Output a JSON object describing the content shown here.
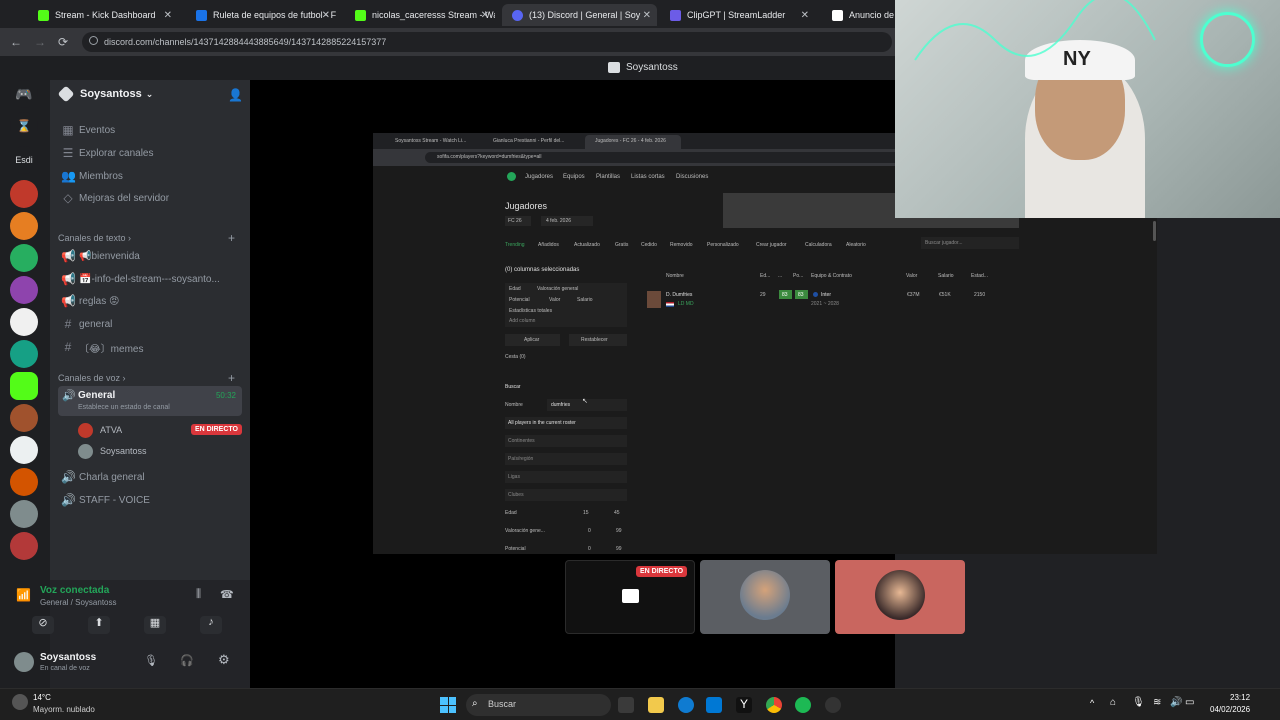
{
  "browser": {
    "tabs": [
      {
        "label": "Stream - Kick Dashboard",
        "color": "#53fc18"
      },
      {
        "label": "Ruleta de equipos de futbol - F",
        "color": "#1a73e8"
      },
      {
        "label": "nicolas_caceresss Stream - Wat",
        "color": "#53fc18"
      },
      {
        "label": "(13) Discord | General | Soy",
        "color": "#5865f2"
      },
      {
        "label": "ClipGPT | StreamLadder",
        "color": "#6c5ce7"
      },
      {
        "label": "Anuncio de las",
        "color": "#ffffff"
      }
    ],
    "url": "discord.com/channels/1437142884443885649/1437142885224157377"
  },
  "discord": {
    "top_title": "Soysantoss",
    "server_name": "Soysantoss",
    "menu": [
      "Eventos",
      "Explorar canales",
      "Miembros",
      "Mejoras del servidor"
    ],
    "text_category": "Canales de texto",
    "text_channels": [
      "📢bienvenida",
      "📅-info-del-stream---soysanto...",
      "reglas 😡",
      "general",
      "〔😂〕memes"
    ],
    "voice_category": "Canales de voz",
    "voice_channel": {
      "name": "General",
      "timer": "50:32",
      "status_placeholder": "Establece un estado de canal"
    },
    "voice_users": [
      {
        "name": "ATVA",
        "badge": "EN DIRECTO"
      },
      {
        "name": "Soysantoss",
        "badge": ""
      }
    ],
    "other_voice": [
      "Charla general",
      "STAFF - VOICE"
    ],
    "voice_connected": {
      "title": "Voz conectada",
      "sub": "General / Soysantoss"
    },
    "user": {
      "name": "Soysantoss",
      "status": "En canal de voz"
    },
    "server_label_esdi": "Esdi",
    "live_badge": "EN DIRECTO"
  },
  "share": {
    "inner_tabs": [
      "Soysantoss Stream - Watch Li...",
      "Gianluca Prestianni - Perfil del...",
      "Jugadores - FC 26 - 4 feb. 2026"
    ],
    "inner_url": "sofifa.com/players?keyword=dumfries&type=all",
    "nav": [
      "Jugadores",
      "Equipos",
      "Plantillas",
      "Listas cortas",
      "Discusiones"
    ],
    "page_title": "Jugadores",
    "version": "FC 26",
    "date": "4 feb. 2026",
    "subnav": [
      "Trending",
      "Añadidos",
      "Actualizado",
      "Gratis",
      "Cedido",
      "Removido",
      "Personalizado",
      "Crear jugador",
      "Calculadora",
      "Aleatorio"
    ],
    "search_placeholder": "Buscar jugador...",
    "columns_title": "(0) columnas seleccionadas",
    "chips": [
      "Edad",
      "Valoración general",
      "Potencial",
      "Valor",
      "Salario",
      "Estadísticas totales"
    ],
    "add_column": "Add column",
    "apply": "Aplicar",
    "reset": "Restablecer",
    "basket": "Cesta (0)",
    "search_section": "Buscar",
    "name_label": "Nombre",
    "name_value": "dumfries",
    "roster": "All players in the current roster",
    "filters": [
      "Continentes",
      "País/región",
      "Ligas",
      "Clubes"
    ],
    "range_rows": [
      {
        "label": "Edad",
        "min": "15",
        "max": "45"
      },
      {
        "label": "Valoración gene...",
        "min": "0",
        "max": "99"
      },
      {
        "label": "Potencial",
        "min": "0",
        "max": "99"
      }
    ],
    "table_headers": [
      "Nombre",
      "Ed...",
      "...",
      "Po...",
      "Equipo & Contrato",
      "Valor",
      "Salario",
      "Estad..."
    ],
    "row": {
      "name": "D. Dumfries",
      "pos": "LD MD",
      "age": "29",
      "ovr": "83",
      "pot": "83",
      "team": "Inter",
      "contract": "2021 ~ 2028",
      "value": "€37M",
      "wage": "€51K",
      "stats": "2150"
    }
  },
  "taskbar": {
    "weather_temp": "14°C",
    "weather_desc": "Mayorm. nublado",
    "search": "Buscar",
    "time": "23:12",
    "date": "04/02/2026"
  }
}
